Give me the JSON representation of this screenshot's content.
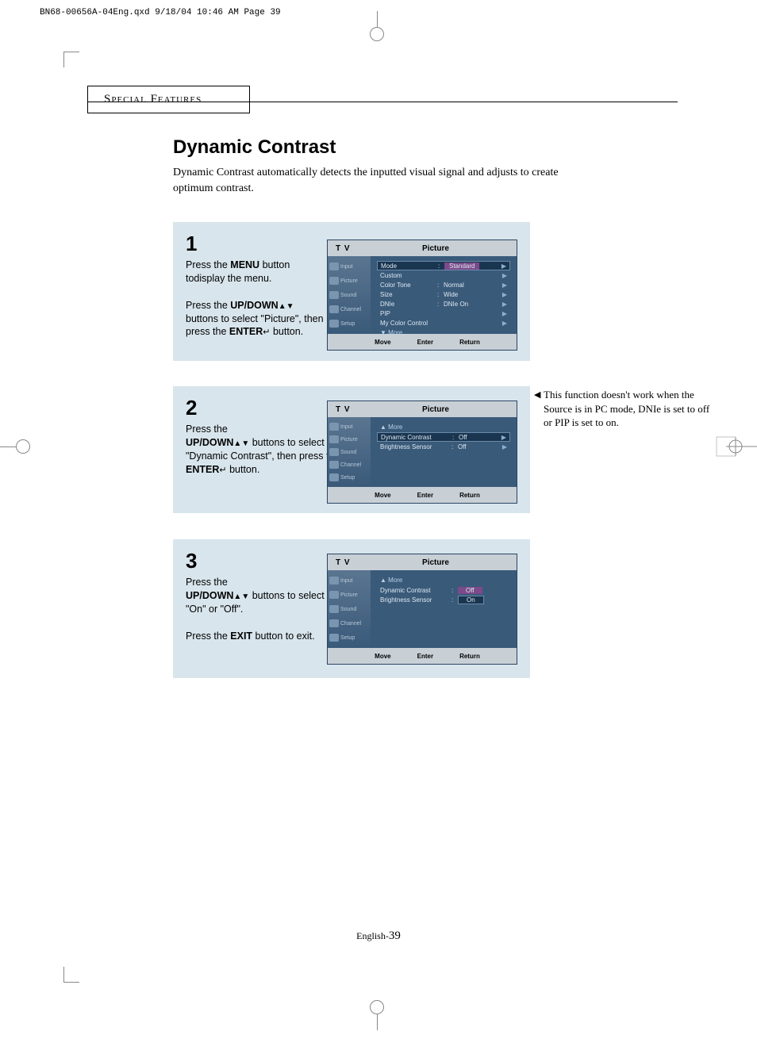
{
  "header_line": "BN68-00656A-04Eng.qxd  9/18/04 10:46 AM  Page 39",
  "section_header": "Special Features",
  "title": "Dynamic Contrast",
  "intro": "Dynamic Contrast automatically detects the inputted visual signal and adjusts to create optimum contrast.",
  "steps": [
    {
      "num": "1",
      "text_parts": {
        "p1_a": "Press the ",
        "p1_b": "MENU",
        "p1_c": " button todisplay the menu.",
        "p2_a": "Press the ",
        "p2_b": "UP/DOWN",
        "p2_c": " buttons to select \"Picture\", then press the ",
        "p2_d": "ENTER",
        "p2_e": " button."
      },
      "osd": {
        "tv": "T V",
        "title": "Picture",
        "side": [
          "Input",
          "Picture",
          "Sound",
          "Channel",
          "Setup"
        ],
        "rows": [
          {
            "k": "Mode",
            "c": ":",
            "v": "Standard",
            "sel": true,
            "ar": "▶"
          },
          {
            "k": "Custom",
            "c": "",
            "v": "",
            "ar": "▶"
          },
          {
            "k": "Color Tone",
            "c": ":",
            "v": "Normal",
            "ar": "▶"
          },
          {
            "k": "Size",
            "c": ":",
            "v": "Wide",
            "ar": "▶"
          },
          {
            "k": "DNIe",
            "c": ":",
            "v": "DNIe On",
            "ar": "▶"
          },
          {
            "k": "PIP",
            "c": "",
            "v": "",
            "ar": "▶"
          },
          {
            "k": "My Color Control",
            "c": "",
            "v": "",
            "ar": "▶"
          }
        ],
        "more": "▼ More",
        "foot": {
          "move": "Move",
          "enter": "Enter",
          "ret": "Return"
        }
      }
    },
    {
      "num": "2",
      "text_parts": {
        "p1_a": "Press the ",
        "p1_b": "UP/DOWN",
        "p1_c": "  buttons to select \"Dynamic Contrast\", then press the ",
        "p1_d": "ENTER",
        "p1_e": " button."
      },
      "osd": {
        "tv": "T V",
        "title": "Picture",
        "side": [
          "Input",
          "Picture",
          "Sound",
          "Channel",
          "Setup"
        ],
        "more_top": "▲ More",
        "rows": [
          {
            "k": "Dynamic Contrast",
            "c": ":",
            "v": "Off",
            "sel": true,
            "ar": "▶"
          },
          {
            "k": "Brightness Sensor",
            "c": ":",
            "v": "Off",
            "ar": "▶"
          }
        ],
        "foot": {
          "move": "Move",
          "enter": "Enter",
          "ret": "Return"
        }
      }
    },
    {
      "num": "3",
      "text_parts": {
        "p1_a": "Press the ",
        "p1_b": "UP/DOWN",
        "p1_c": " buttons to select \"On\" or \"Off\".",
        "p2_a": "Press the ",
        "p2_b": "EXIT",
        "p2_c": " button to exit."
      },
      "osd": {
        "tv": "T V",
        "title": "Picture",
        "side": [
          "Input",
          "Picture",
          "Sound",
          "Channel",
          "Setup"
        ],
        "more_top": "▲ More",
        "rows": [
          {
            "k": "Dynamic Contrast",
            "c": ":",
            "v": "Off",
            "sel3": true
          },
          {
            "k": "Brightness Sensor",
            "c": ":",
            "v": "On",
            "sel3b": true
          }
        ],
        "foot": {
          "move": "Move",
          "enter": "Enter",
          "ret": "Return"
        }
      }
    }
  ],
  "side_note": "This function doesn't work when the Source is in PC mode, DNIe is set to off or PIP is set to on.",
  "side_note_tri": "◀",
  "footer_prefix": "English-",
  "footer_page": "39"
}
